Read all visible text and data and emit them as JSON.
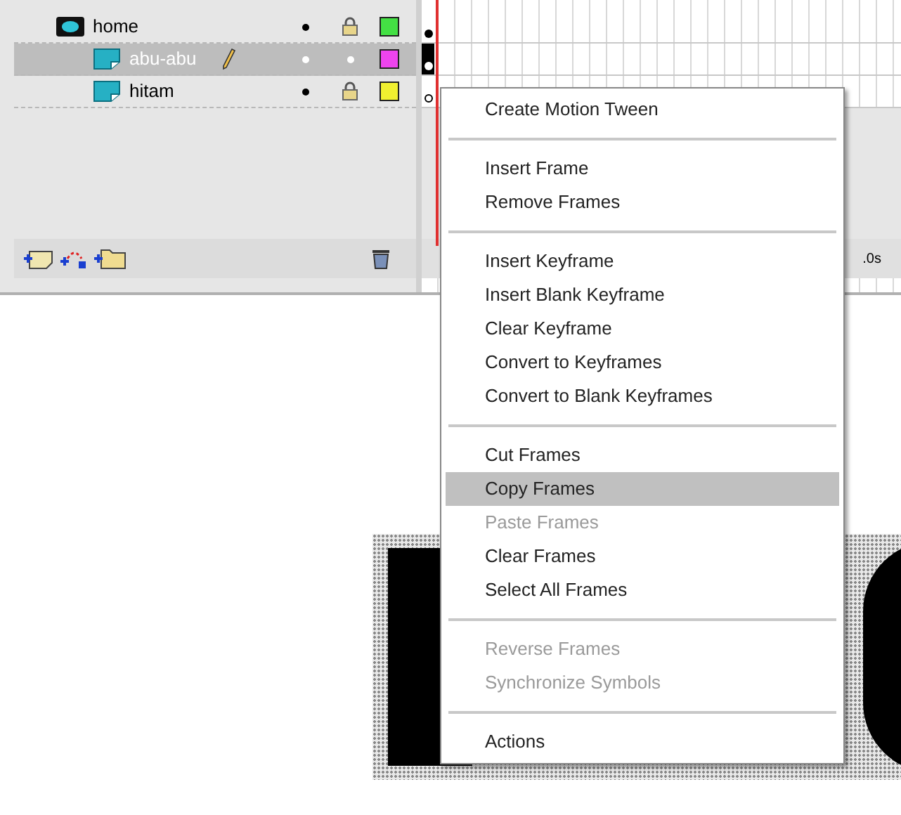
{
  "layers": [
    {
      "name": "home",
      "kind": "mask",
      "selected": false,
      "locked": true,
      "color": "#44e044",
      "keyframe_filled": true,
      "children": [
        {
          "name": "abu-abu",
          "kind": "masked",
          "selected": true,
          "locked": false,
          "color": "#ee44ee",
          "keyframe_filled": true
        },
        {
          "name": "hitam",
          "kind": "masked",
          "selected": false,
          "locked": true,
          "color": "#f0f030",
          "keyframe_filled": false
        }
      ]
    }
  ],
  "timeline": {
    "elapsed": ".0s"
  },
  "context_menu": [
    {
      "label": "Create Motion Tween",
      "disabled": false,
      "selected": false,
      "separator_before": false
    },
    {
      "label": "Insert Frame",
      "disabled": false,
      "selected": false,
      "separator_before": true
    },
    {
      "label": "Remove Frames",
      "disabled": false,
      "selected": false,
      "separator_before": false
    },
    {
      "label": "Insert Keyframe",
      "disabled": false,
      "selected": false,
      "separator_before": true
    },
    {
      "label": "Insert Blank Keyframe",
      "disabled": false,
      "selected": false,
      "separator_before": false
    },
    {
      "label": "Clear Keyframe",
      "disabled": false,
      "selected": false,
      "separator_before": false
    },
    {
      "label": "Convert to Keyframes",
      "disabled": false,
      "selected": false,
      "separator_before": false
    },
    {
      "label": "Convert to Blank Keyframes",
      "disabled": false,
      "selected": false,
      "separator_before": false
    },
    {
      "label": "Cut Frames",
      "disabled": false,
      "selected": false,
      "separator_before": true
    },
    {
      "label": "Copy Frames",
      "disabled": false,
      "selected": true,
      "separator_before": false
    },
    {
      "label": "Paste Frames",
      "disabled": true,
      "selected": false,
      "separator_before": false
    },
    {
      "label": "Clear Frames",
      "disabled": false,
      "selected": false,
      "separator_before": false
    },
    {
      "label": "Select All Frames",
      "disabled": false,
      "selected": false,
      "separator_before": false
    },
    {
      "label": "Reverse Frames",
      "disabled": true,
      "selected": false,
      "separator_before": true
    },
    {
      "label": "Synchronize Symbols",
      "disabled": true,
      "selected": false,
      "separator_before": false
    },
    {
      "label": "Actions",
      "disabled": false,
      "selected": false,
      "separator_before": true
    }
  ]
}
